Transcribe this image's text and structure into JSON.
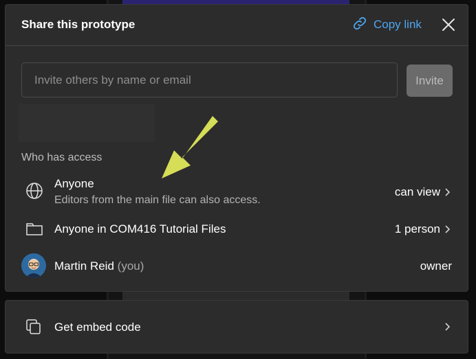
{
  "header": {
    "title": "Share this prototype",
    "copy_link_label": "Copy link"
  },
  "invite": {
    "placeholder": "Invite others by name or email",
    "button_label": "Invite"
  },
  "access": {
    "section_label": "Who has access",
    "rows": [
      {
        "name": "Anyone",
        "subtitle": "Editors from the main file can also access.",
        "permission": "can view",
        "icon": "globe-icon"
      },
      {
        "name": "Anyone in COM416 Tutorial Files",
        "permission": "1 person",
        "icon": "folder-icon"
      },
      {
        "name": "Martin Reid",
        "you_label": "(you)",
        "permission": "owner",
        "icon": "avatar"
      }
    ]
  },
  "embed": {
    "label": "Get embed code"
  },
  "colors": {
    "accent": "#4fa6f0",
    "annotation": "#d6dd57",
    "panel": "#2c2c2c"
  }
}
